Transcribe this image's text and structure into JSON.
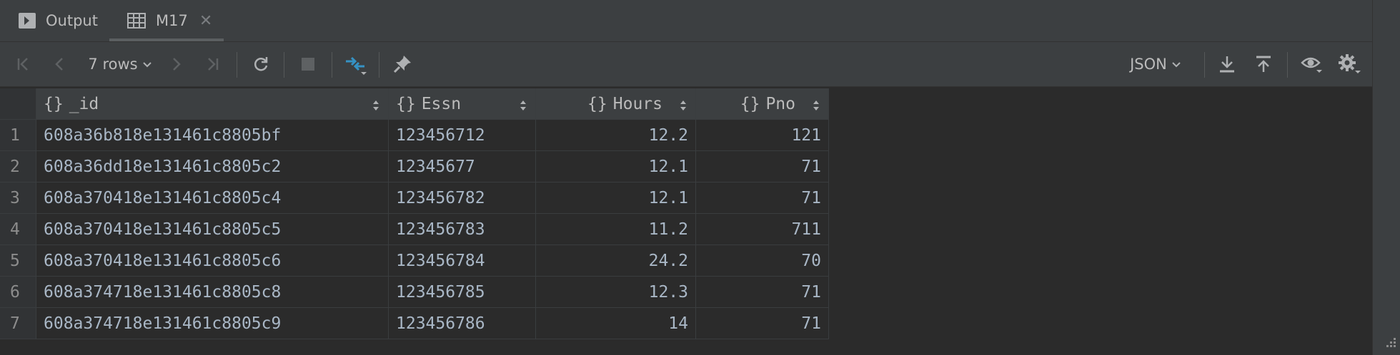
{
  "tabs": {
    "output_label": "Output",
    "m17_label": "M17"
  },
  "toolbar": {
    "rows_label": "7 rows",
    "format_label": "JSON",
    "icons": [
      "first-page-icon",
      "prev-page-icon",
      "next-page-icon",
      "last-page-icon",
      "refresh-icon",
      "stop-icon",
      "compare-icon",
      "pin-icon",
      "download-icon",
      "upload-icon",
      "eye-icon",
      "gear-icon"
    ]
  },
  "table": {
    "columns": [
      {
        "brace": "{}",
        "name": "_id"
      },
      {
        "brace": "{}",
        "name": "Essn"
      },
      {
        "brace": "{}",
        "name": "Hours"
      },
      {
        "brace": "{}",
        "name": "Pno"
      }
    ],
    "rows": [
      {
        "num": "1",
        "id": "608a36b818e131461c8805bf",
        "essn": "123456712",
        "hours": "12.2",
        "pno": "121"
      },
      {
        "num": "2",
        "id": "608a36dd18e131461c8805c2",
        "essn": "12345677",
        "hours": "12.1",
        "pno": "71"
      },
      {
        "num": "3",
        "id": "608a370418e131461c8805c4",
        "essn": "123456782",
        "hours": "12.1",
        "pno": "71"
      },
      {
        "num": "4",
        "id": "608a370418e131461c8805c5",
        "essn": "123456783",
        "hours": "11.2",
        "pno": "711"
      },
      {
        "num": "5",
        "id": "608a370418e131461c8805c6",
        "essn": "123456784",
        "hours": "24.2",
        "pno": "70"
      },
      {
        "num": "6",
        "id": "608a374718e131461c8805c8",
        "essn": "123456785",
        "hours": "12.3",
        "pno": "71"
      },
      {
        "num": "7",
        "id": "608a374718e131461c8805c9",
        "essn": "123456786",
        "hours": "14",
        "pno": "71"
      }
    ]
  },
  "colors": {
    "panel": "#3c3f41",
    "background": "#2b2b2b",
    "accent_blue": "#3592c4"
  }
}
